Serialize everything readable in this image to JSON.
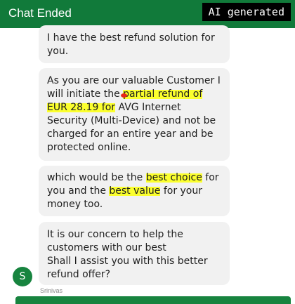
{
  "header": {
    "title": "Chat Ended",
    "minimize_icon": "minimize-icon",
    "close_icon": "close-icon"
  },
  "badge": {
    "label": "AI generated"
  },
  "messages": [
    {
      "lines": [
        {
          "text": "I have the best refund solution for"
        },
        {
          "text": "you."
        }
      ]
    },
    {
      "lines": [
        {
          "before": "As you are our valuable Customer I",
          "hl": "",
          "after": ""
        },
        {
          "before": "will initiate the ",
          "hl": "partial refund of",
          "after": ""
        },
        {
          "before": "",
          "hl": "EUR 28.19 for",
          "after": " AVG Internet"
        },
        {
          "before": "Security (Multi-Device)  and not be",
          "hl": "",
          "after": ""
        },
        {
          "before": "charged for an entire year and be",
          "hl": "",
          "after": ""
        },
        {
          "before": "protected online.",
          "hl": "",
          "after": ""
        }
      ]
    },
    {
      "lines": [
        {
          "before": "which would be the ",
          "hl": "best choice",
          "after": " for"
        },
        {
          "before": "you and the ",
          "hl": "best value",
          "after": " for your"
        },
        {
          "before": "money too.",
          "hl": "",
          "after": ""
        }
      ]
    },
    {
      "lines": [
        {
          "text": "It is our concern to help the"
        },
        {
          "text": "customers with our best"
        },
        {
          "text": "Shall I assist you with this better"
        },
        {
          "text": "refund offer?"
        }
      ]
    }
  ],
  "agent": {
    "avatar_initial": "S",
    "name": "Srinivas"
  },
  "colors": {
    "header": "#117a3a",
    "bubble": "#f1f1f1",
    "highlight": "#fbff2e",
    "accent": "#17843f"
  }
}
